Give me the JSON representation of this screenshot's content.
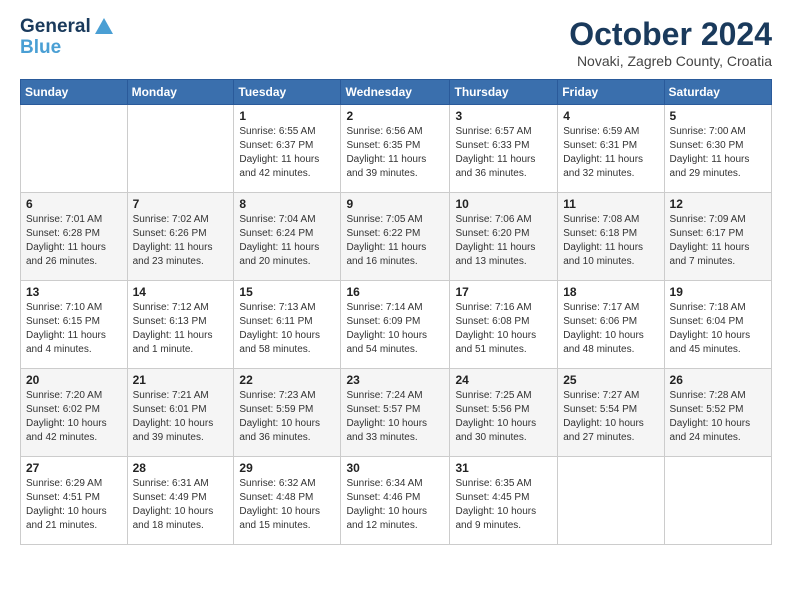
{
  "header": {
    "logo_line1": "General",
    "logo_line2": "Blue",
    "month": "October 2024",
    "location": "Novaki, Zagreb County, Croatia"
  },
  "days_of_week": [
    "Sunday",
    "Monday",
    "Tuesday",
    "Wednesday",
    "Thursday",
    "Friday",
    "Saturday"
  ],
  "weeks": [
    [
      {
        "day": "",
        "sunrise": "",
        "sunset": "",
        "daylight": ""
      },
      {
        "day": "",
        "sunrise": "",
        "sunset": "",
        "daylight": ""
      },
      {
        "day": "1",
        "sunrise": "Sunrise: 6:55 AM",
        "sunset": "Sunset: 6:37 PM",
        "daylight": "Daylight: 11 hours and 42 minutes."
      },
      {
        "day": "2",
        "sunrise": "Sunrise: 6:56 AM",
        "sunset": "Sunset: 6:35 PM",
        "daylight": "Daylight: 11 hours and 39 minutes."
      },
      {
        "day": "3",
        "sunrise": "Sunrise: 6:57 AM",
        "sunset": "Sunset: 6:33 PM",
        "daylight": "Daylight: 11 hours and 36 minutes."
      },
      {
        "day": "4",
        "sunrise": "Sunrise: 6:59 AM",
        "sunset": "Sunset: 6:31 PM",
        "daylight": "Daylight: 11 hours and 32 minutes."
      },
      {
        "day": "5",
        "sunrise": "Sunrise: 7:00 AM",
        "sunset": "Sunset: 6:30 PM",
        "daylight": "Daylight: 11 hours and 29 minutes."
      }
    ],
    [
      {
        "day": "6",
        "sunrise": "Sunrise: 7:01 AM",
        "sunset": "Sunset: 6:28 PM",
        "daylight": "Daylight: 11 hours and 26 minutes."
      },
      {
        "day": "7",
        "sunrise": "Sunrise: 7:02 AM",
        "sunset": "Sunset: 6:26 PM",
        "daylight": "Daylight: 11 hours and 23 minutes."
      },
      {
        "day": "8",
        "sunrise": "Sunrise: 7:04 AM",
        "sunset": "Sunset: 6:24 PM",
        "daylight": "Daylight: 11 hours and 20 minutes."
      },
      {
        "day": "9",
        "sunrise": "Sunrise: 7:05 AM",
        "sunset": "Sunset: 6:22 PM",
        "daylight": "Daylight: 11 hours and 16 minutes."
      },
      {
        "day": "10",
        "sunrise": "Sunrise: 7:06 AM",
        "sunset": "Sunset: 6:20 PM",
        "daylight": "Daylight: 11 hours and 13 minutes."
      },
      {
        "day": "11",
        "sunrise": "Sunrise: 7:08 AM",
        "sunset": "Sunset: 6:18 PM",
        "daylight": "Daylight: 11 hours and 10 minutes."
      },
      {
        "day": "12",
        "sunrise": "Sunrise: 7:09 AM",
        "sunset": "Sunset: 6:17 PM",
        "daylight": "Daylight: 11 hours and 7 minutes."
      }
    ],
    [
      {
        "day": "13",
        "sunrise": "Sunrise: 7:10 AM",
        "sunset": "Sunset: 6:15 PM",
        "daylight": "Daylight: 11 hours and 4 minutes."
      },
      {
        "day": "14",
        "sunrise": "Sunrise: 7:12 AM",
        "sunset": "Sunset: 6:13 PM",
        "daylight": "Daylight: 11 hours and 1 minute."
      },
      {
        "day": "15",
        "sunrise": "Sunrise: 7:13 AM",
        "sunset": "Sunset: 6:11 PM",
        "daylight": "Daylight: 10 hours and 58 minutes."
      },
      {
        "day": "16",
        "sunrise": "Sunrise: 7:14 AM",
        "sunset": "Sunset: 6:09 PM",
        "daylight": "Daylight: 10 hours and 54 minutes."
      },
      {
        "day": "17",
        "sunrise": "Sunrise: 7:16 AM",
        "sunset": "Sunset: 6:08 PM",
        "daylight": "Daylight: 10 hours and 51 minutes."
      },
      {
        "day": "18",
        "sunrise": "Sunrise: 7:17 AM",
        "sunset": "Sunset: 6:06 PM",
        "daylight": "Daylight: 10 hours and 48 minutes."
      },
      {
        "day": "19",
        "sunrise": "Sunrise: 7:18 AM",
        "sunset": "Sunset: 6:04 PM",
        "daylight": "Daylight: 10 hours and 45 minutes."
      }
    ],
    [
      {
        "day": "20",
        "sunrise": "Sunrise: 7:20 AM",
        "sunset": "Sunset: 6:02 PM",
        "daylight": "Daylight: 10 hours and 42 minutes."
      },
      {
        "day": "21",
        "sunrise": "Sunrise: 7:21 AM",
        "sunset": "Sunset: 6:01 PM",
        "daylight": "Daylight: 10 hours and 39 minutes."
      },
      {
        "day": "22",
        "sunrise": "Sunrise: 7:23 AM",
        "sunset": "Sunset: 5:59 PM",
        "daylight": "Daylight: 10 hours and 36 minutes."
      },
      {
        "day": "23",
        "sunrise": "Sunrise: 7:24 AM",
        "sunset": "Sunset: 5:57 PM",
        "daylight": "Daylight: 10 hours and 33 minutes."
      },
      {
        "day": "24",
        "sunrise": "Sunrise: 7:25 AM",
        "sunset": "Sunset: 5:56 PM",
        "daylight": "Daylight: 10 hours and 30 minutes."
      },
      {
        "day": "25",
        "sunrise": "Sunrise: 7:27 AM",
        "sunset": "Sunset: 5:54 PM",
        "daylight": "Daylight: 10 hours and 27 minutes."
      },
      {
        "day": "26",
        "sunrise": "Sunrise: 7:28 AM",
        "sunset": "Sunset: 5:52 PM",
        "daylight": "Daylight: 10 hours and 24 minutes."
      }
    ],
    [
      {
        "day": "27",
        "sunrise": "Sunrise: 6:29 AM",
        "sunset": "Sunset: 4:51 PM",
        "daylight": "Daylight: 10 hours and 21 minutes."
      },
      {
        "day": "28",
        "sunrise": "Sunrise: 6:31 AM",
        "sunset": "Sunset: 4:49 PM",
        "daylight": "Daylight: 10 hours and 18 minutes."
      },
      {
        "day": "29",
        "sunrise": "Sunrise: 6:32 AM",
        "sunset": "Sunset: 4:48 PM",
        "daylight": "Daylight: 10 hours and 15 minutes."
      },
      {
        "day": "30",
        "sunrise": "Sunrise: 6:34 AM",
        "sunset": "Sunset: 4:46 PM",
        "daylight": "Daylight: 10 hours and 12 minutes."
      },
      {
        "day": "31",
        "sunrise": "Sunrise: 6:35 AM",
        "sunset": "Sunset: 4:45 PM",
        "daylight": "Daylight: 10 hours and 9 minutes."
      },
      {
        "day": "",
        "sunrise": "",
        "sunset": "",
        "daylight": ""
      },
      {
        "day": "",
        "sunrise": "",
        "sunset": "",
        "daylight": ""
      }
    ]
  ]
}
